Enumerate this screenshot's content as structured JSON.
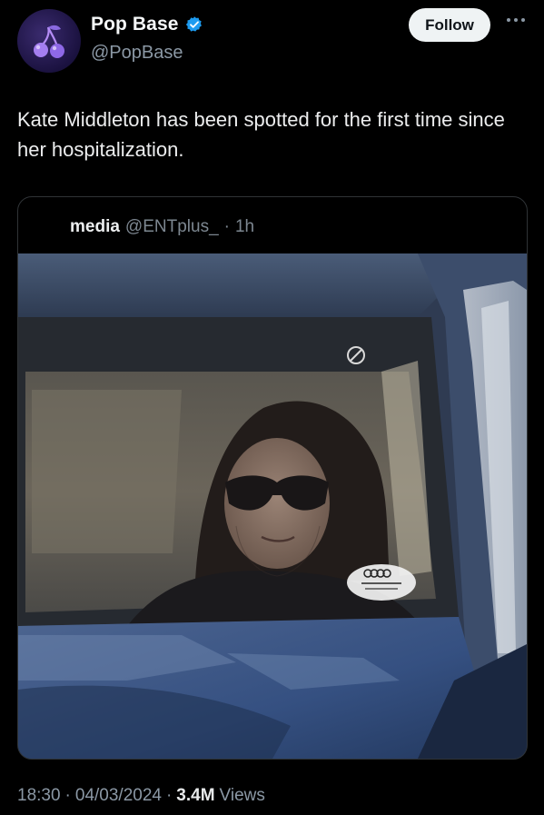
{
  "account": {
    "display_name": "Pop Base",
    "handle": "@PopBase",
    "verified_icon": "verified-badge-icon",
    "avatar_icon": "cherries-icon",
    "follow_label": "Follow",
    "more_icon": "more-dots-icon"
  },
  "tweet": {
    "text": "Kate Middleton has been spotted for the first time since her hospitalization."
  },
  "quote": {
    "name": "media",
    "handle": "@ENTplus_",
    "separator": "·",
    "time": "1h",
    "media_icon": "photo-of-person-in-car"
  },
  "meta": {
    "time": "18:30",
    "separator": "·",
    "date": "04/03/2024",
    "views_count": "3.4M",
    "views_label": "Views"
  },
  "colors": {
    "background": "#000000",
    "text_primary": "#e7e9ea",
    "text_secondary": "#8b98a5",
    "verified": "#1d9bf0",
    "follow_bg": "#eff3f4",
    "card_border": "#2f3336"
  }
}
